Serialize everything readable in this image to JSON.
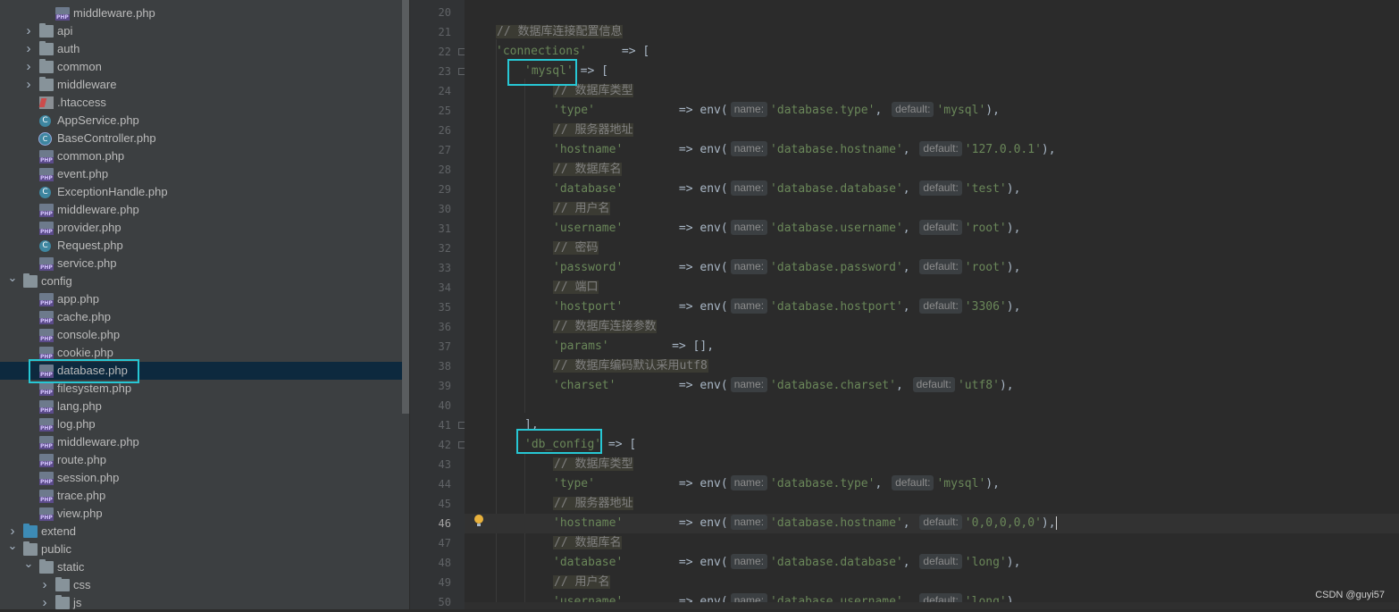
{
  "tree": {
    "items": [
      {
        "label": "middleware.php",
        "kind": "php"
      },
      {
        "label": "api",
        "kind": "folder"
      },
      {
        "label": "auth",
        "kind": "folder"
      },
      {
        "label": "common",
        "kind": "folder"
      },
      {
        "label": "middleware",
        "kind": "folder"
      },
      {
        "label": ".htaccess",
        "kind": "htaccess"
      },
      {
        "label": "AppService.php",
        "kind": "class"
      },
      {
        "label": "BaseController.php",
        "kind": "abstract"
      },
      {
        "label": "common.php",
        "kind": "php"
      },
      {
        "label": "event.php",
        "kind": "php"
      },
      {
        "label": "ExceptionHandle.php",
        "kind": "class"
      },
      {
        "label": "middleware.php",
        "kind": "php"
      },
      {
        "label": "provider.php",
        "kind": "php"
      },
      {
        "label": "Request.php",
        "kind": "class"
      },
      {
        "label": "service.php",
        "kind": "php"
      },
      {
        "label": "config",
        "kind": "folder-open"
      },
      {
        "label": "app.php",
        "kind": "php"
      },
      {
        "label": "cache.php",
        "kind": "php"
      },
      {
        "label": "console.php",
        "kind": "php"
      },
      {
        "label": "cookie.php",
        "kind": "php"
      },
      {
        "label": "database.php",
        "kind": "php"
      },
      {
        "label": "filesystem.php",
        "kind": "php"
      },
      {
        "label": "lang.php",
        "kind": "php"
      },
      {
        "label": "log.php",
        "kind": "php"
      },
      {
        "label": "middleware.php",
        "kind": "php"
      },
      {
        "label": "route.php",
        "kind": "php"
      },
      {
        "label": "session.php",
        "kind": "php"
      },
      {
        "label": "trace.php",
        "kind": "php"
      },
      {
        "label": "view.php",
        "kind": "php"
      },
      {
        "label": "extend",
        "kind": "folder-blue"
      },
      {
        "label": "public",
        "kind": "folder-open"
      },
      {
        "label": "static",
        "kind": "folder-open"
      },
      {
        "label": "css",
        "kind": "folder"
      },
      {
        "label": "js",
        "kind": "folder"
      }
    ],
    "selected_label": "database.php"
  },
  "editor": {
    "active_line": "46",
    "hint_name": "name:",
    "hint_default": "default:",
    "lines": [
      {
        "n": "20"
      },
      {
        "n": "21",
        "comment": "// 数据库连接配置信息"
      },
      {
        "n": "22",
        "key": "'connections'",
        "op": "     => ["
      },
      {
        "n": "23",
        "key": "'mysql'",
        "op": " => ["
      },
      {
        "n": "24",
        "comment": "// 数据库类型"
      },
      {
        "n": "25",
        "key": "'type'",
        "pad": "           ",
        "arg1": "'database.type'",
        "arg2": "'mysql'"
      },
      {
        "n": "26",
        "comment": "// 服务器地址"
      },
      {
        "n": "27",
        "key": "'hostname'",
        "pad": "       ",
        "arg1": "'database.hostname'",
        "arg2": "'127.0.0.1'"
      },
      {
        "n": "28",
        "comment": "// 数据库名"
      },
      {
        "n": "29",
        "key": "'database'",
        "pad": "       ",
        "arg1": "'database.database'",
        "arg2": "'test'"
      },
      {
        "n": "30",
        "comment": "// 用户名"
      },
      {
        "n": "31",
        "key": "'username'",
        "pad": "       ",
        "arg1": "'database.username'",
        "arg2": "'root'"
      },
      {
        "n": "32",
        "comment": "// 密码"
      },
      {
        "n": "33",
        "key": "'password'",
        "pad": "       ",
        "arg1": "'database.password'",
        "arg2": "'root'"
      },
      {
        "n": "34",
        "comment": "// 端口"
      },
      {
        "n": "35",
        "key": "'hostport'",
        "pad": "       ",
        "arg1": "'database.hostport'",
        "arg2": "'3306'"
      },
      {
        "n": "36",
        "comment": "// 数据库连接参数"
      },
      {
        "n": "37",
        "key": "'params'",
        "op": "         => [],"
      },
      {
        "n": "38",
        "comment": "// 数据库编码默认采用utf8"
      },
      {
        "n": "39",
        "key": "'charset'",
        "pad": "        ",
        "arg1": "'database.charset'",
        "arg2": "'utf8'"
      },
      {
        "n": "40"
      },
      {
        "n": "41",
        "close": "],"
      },
      {
        "n": "42",
        "key": "'db_config'",
        "op": " => ["
      },
      {
        "n": "43",
        "comment": "// 数据库类型"
      },
      {
        "n": "44",
        "key": "'type'",
        "pad": "           ",
        "arg1": "'database.type'",
        "arg2": "'mysql'"
      },
      {
        "n": "45",
        "comment": "// 服务器地址"
      },
      {
        "n": "46",
        "key": "'hostname'",
        "pad": "       ",
        "arg1": "'database.hostname'",
        "arg2": "'0,0,0,0,0'"
      },
      {
        "n": "47",
        "comment": "// 数据库名"
      },
      {
        "n": "48",
        "key": "'database'",
        "pad": "       ",
        "arg1": "'database.database'",
        "arg2": "'long'"
      },
      {
        "n": "49",
        "comment": "// 用户名"
      },
      {
        "n": "50",
        "key": "'username'",
        "pad": "       ",
        "arg1": "'database.username'",
        "arg2": "'long'"
      }
    ]
  },
  "watermark": "CSDN @guyi57",
  "colors": {
    "highlight_box": "#27c7d4",
    "selection": "#0d293e",
    "string": "#6a8759",
    "comment": "#808080"
  }
}
